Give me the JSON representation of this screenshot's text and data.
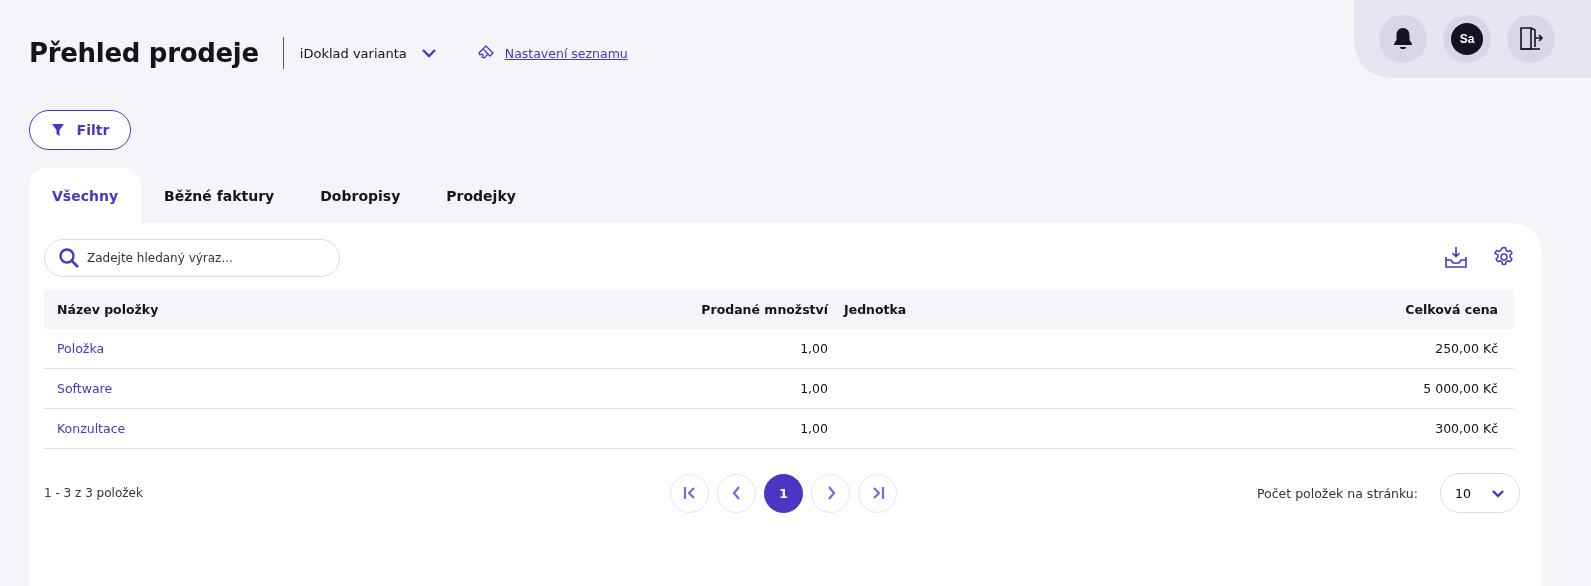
{
  "header": {
    "title": "Přehled prodeje",
    "variant": "iDoklad varianta",
    "settings_link": "Nastavení seznamu",
    "user_initials": "Sa"
  },
  "filter_button": "Filtr",
  "tabs": [
    {
      "label": "Všechny",
      "selected": true
    },
    {
      "label": "Běžné faktury",
      "selected": false
    },
    {
      "label": "Dobropisy",
      "selected": false
    },
    {
      "label": "Prodejky",
      "selected": false
    }
  ],
  "search": {
    "placeholder": "Zadejte hledaný výraz..."
  },
  "table": {
    "columns": [
      "Název položky",
      "Prodané množství",
      "Jednotka",
      "Celková cena"
    ],
    "rows": [
      {
        "name": "Položka",
        "quantity": "1,00",
        "total": "250,00 Kč"
      },
      {
        "name": "Software",
        "quantity": "1,00",
        "total": "5 000,00 Kč"
      },
      {
        "name": "Konzultace",
        "quantity": "1,00",
        "total": "300,00 Kč"
      }
    ]
  },
  "pagination": {
    "summary": "1 - 3 z 3 položek",
    "pages": [
      {
        "label": "1",
        "selected": true
      }
    ],
    "page_size_label": "Počet položek na stránku:",
    "page_size": "10"
  }
}
